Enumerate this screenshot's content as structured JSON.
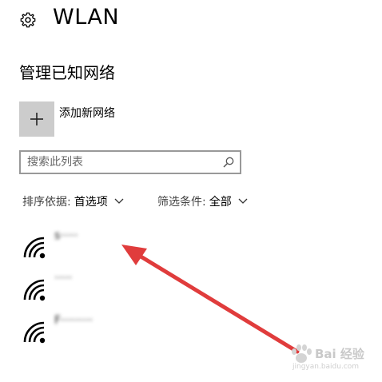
{
  "header": {
    "title": "WLAN",
    "icon": "gear-icon"
  },
  "page": {
    "subtitle": "管理已知网络"
  },
  "add_network": {
    "icon": "plus-icon",
    "label": "添加新网络"
  },
  "search": {
    "placeholder": "搜索此列表",
    "icon": "search-icon"
  },
  "sort": {
    "label": "排序依据:",
    "value": "首选项"
  },
  "filter": {
    "label": "筛选条件:",
    "value": "全部"
  },
  "networks": [
    {
      "ssid": "s·····",
      "icon": "wifi-signal-icon"
    },
    {
      "ssid": "·····",
      "icon": "wifi-signal-icon"
    },
    {
      "ssid": "F·········",
      "icon": "wifi-signal-icon"
    }
  ],
  "annotation": {
    "color": "#e03c3c"
  },
  "watermark": {
    "text": "Bai 经验",
    "subtext": "jingyan.baidu.com"
  }
}
